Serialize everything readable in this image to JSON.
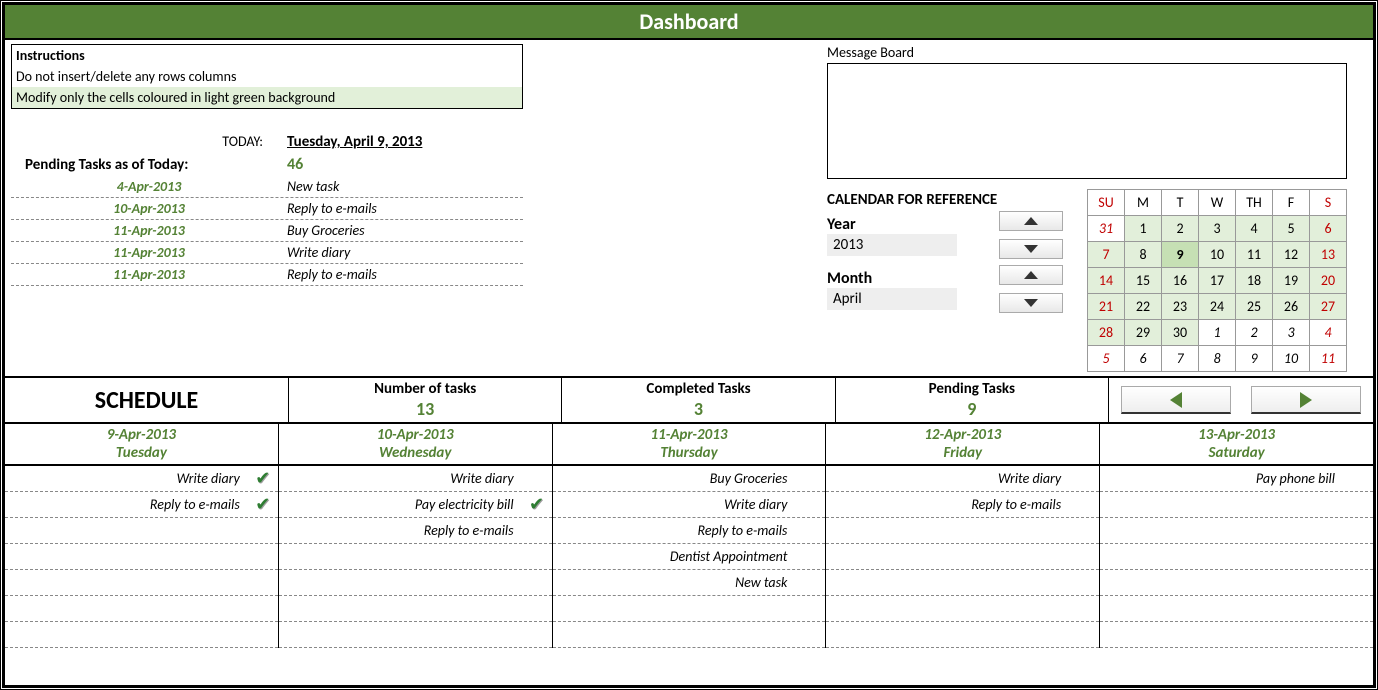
{
  "title": "Dashboard",
  "instructions": {
    "header": "Instructions",
    "line1": "Do not insert/delete any rows columns",
    "line2": "Modify only the cells coloured in light green background"
  },
  "today": {
    "label": "TODAY:",
    "value": "Tuesday, April 9, 2013"
  },
  "pending_summary": {
    "label": "Pending Tasks as of Today:",
    "count": "46"
  },
  "pending_list": [
    {
      "date": "4-Apr-2013",
      "task": "New task"
    },
    {
      "date": "10-Apr-2013",
      "task": "Reply to e-mails"
    },
    {
      "date": "11-Apr-2013",
      "task": "Buy Groceries"
    },
    {
      "date": "11-Apr-2013",
      "task": "Write diary"
    },
    {
      "date": "11-Apr-2013",
      "task": "Reply to e-mails"
    }
  ],
  "message_board": {
    "label": "Message Board",
    "content": ""
  },
  "calendar_ref": {
    "title": "CALENDAR FOR REFERENCE",
    "year_label": "Year",
    "year_value": "2013",
    "month_label": "Month",
    "month_value": "April"
  },
  "mini_calendar": {
    "headers": [
      "SU",
      "M",
      "T",
      "W",
      "TH",
      "F",
      "S"
    ],
    "rows": [
      [
        {
          "d": "31",
          "o": true,
          "we": true
        },
        {
          "d": "1"
        },
        {
          "d": "2"
        },
        {
          "d": "3"
        },
        {
          "d": "4"
        },
        {
          "d": "5"
        },
        {
          "d": "6",
          "we": true
        }
      ],
      [
        {
          "d": "7",
          "we": true
        },
        {
          "d": "8"
        },
        {
          "d": "9",
          "today": true
        },
        {
          "d": "10"
        },
        {
          "d": "11"
        },
        {
          "d": "12"
        },
        {
          "d": "13",
          "we": true
        }
      ],
      [
        {
          "d": "14",
          "we": true
        },
        {
          "d": "15"
        },
        {
          "d": "16"
        },
        {
          "d": "17"
        },
        {
          "d": "18"
        },
        {
          "d": "19"
        },
        {
          "d": "20",
          "we": true
        }
      ],
      [
        {
          "d": "21",
          "we": true
        },
        {
          "d": "22"
        },
        {
          "d": "23"
        },
        {
          "d": "24"
        },
        {
          "d": "25"
        },
        {
          "d": "26"
        },
        {
          "d": "27",
          "we": true
        }
      ],
      [
        {
          "d": "28",
          "we": true
        },
        {
          "d": "29"
        },
        {
          "d": "30"
        },
        {
          "d": "1",
          "o": true
        },
        {
          "d": "2",
          "o": true
        },
        {
          "d": "3",
          "o": true
        },
        {
          "d": "4",
          "o": true,
          "we": true
        }
      ],
      [
        {
          "d": "5",
          "o": true,
          "we": true
        },
        {
          "d": "6",
          "o": true
        },
        {
          "d": "7",
          "o": true
        },
        {
          "d": "8",
          "o": true
        },
        {
          "d": "9",
          "o": true
        },
        {
          "d": "10",
          "o": true
        },
        {
          "d": "11",
          "o": true,
          "we": true
        }
      ]
    ]
  },
  "schedule_title": "SCHEDULE",
  "stats": {
    "num_tasks_label": "Number of tasks",
    "num_tasks": "13",
    "completed_label": "Completed Tasks",
    "completed": "3",
    "pending_label": "Pending Tasks",
    "pending": "9"
  },
  "day_headers": [
    {
      "date": "9-Apr-2013",
      "dow": "Tuesday"
    },
    {
      "date": "10-Apr-2013",
      "dow": "Wednesday"
    },
    {
      "date": "11-Apr-2013",
      "dow": "Thursday"
    },
    {
      "date": "12-Apr-2013",
      "dow": "Friday"
    },
    {
      "date": "13-Apr-2013",
      "dow": "Saturday"
    }
  ],
  "schedule": [
    [
      {
        "t": "Write diary",
        "done": true
      },
      {
        "t": "Reply to e-mails",
        "done": true
      },
      {
        "t": ""
      },
      {
        "t": ""
      },
      {
        "t": ""
      },
      {
        "t": ""
      },
      {
        "t": ""
      }
    ],
    [
      {
        "t": "Write diary"
      },
      {
        "t": "Pay electricity bill",
        "done": true
      },
      {
        "t": "Reply to e-mails"
      },
      {
        "t": ""
      },
      {
        "t": ""
      },
      {
        "t": ""
      },
      {
        "t": ""
      }
    ],
    [
      {
        "t": "Buy Groceries"
      },
      {
        "t": "Write diary"
      },
      {
        "t": "Reply to e-mails"
      },
      {
        "t": "Dentist Appointment"
      },
      {
        "t": "New task"
      },
      {
        "t": ""
      },
      {
        "t": ""
      }
    ],
    [
      {
        "t": "Write diary"
      },
      {
        "t": "Reply to e-mails"
      },
      {
        "t": ""
      },
      {
        "t": ""
      },
      {
        "t": ""
      },
      {
        "t": ""
      },
      {
        "t": ""
      }
    ],
    [
      {
        "t": "Pay phone bill"
      },
      {
        "t": ""
      },
      {
        "t": ""
      },
      {
        "t": ""
      },
      {
        "t": ""
      },
      {
        "t": ""
      },
      {
        "t": ""
      }
    ]
  ]
}
